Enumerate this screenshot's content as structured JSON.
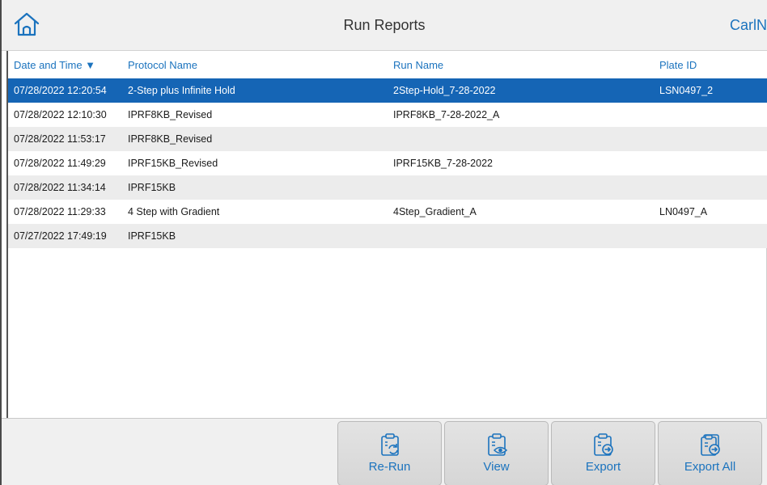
{
  "header": {
    "title": "Run Reports",
    "user": "CarlN"
  },
  "table": {
    "columns": [
      "Date and Time ▼",
      "Protocol Name",
      "Run Name",
      "Plate ID"
    ],
    "rows": [
      {
        "date": "07/28/2022 12:20:54",
        "protocol": "2-Step plus Infinite Hold",
        "run": "2Step-Hold_7-28-2022",
        "plate": "LSN0497_2"
      },
      {
        "date": "07/28/2022 12:10:30",
        "protocol": "IPRF8KB_Revised",
        "run": "IPRF8KB_7-28-2022_A",
        "plate": ""
      },
      {
        "date": "07/28/2022 11:53:17",
        "protocol": "IPRF8KB_Revised",
        "run": "",
        "plate": ""
      },
      {
        "date": "07/28/2022 11:49:29",
        "protocol": "IPRF15KB_Revised",
        "run": "IPRF15KB_7-28-2022",
        "plate": ""
      },
      {
        "date": "07/28/2022 11:34:14",
        "protocol": "IPRF15KB",
        "run": "",
        "plate": ""
      },
      {
        "date": "07/28/2022 11:29:33",
        "protocol": "4 Step with Gradient",
        "run": "4Step_Gradient_A",
        "plate": "LN0497_A"
      },
      {
        "date": "07/27/2022 17:49:19",
        "protocol": "IPRF15KB",
        "run": "",
        "plate": ""
      }
    ]
  },
  "footer": {
    "rerun_label": "Re-Run",
    "view_label": "View",
    "export_label": "Export",
    "export_all_label": "Export All"
  },
  "icons": {
    "home": "home-icon",
    "rerun": "clipboard-refresh-icon",
    "view": "clipboard-eye-icon",
    "export": "clipboard-export-icon",
    "export_all": "clipboards-export-icon"
  },
  "colors": {
    "accent": "#1b73be",
    "selected_row": "#1565b5",
    "header_bg": "#f0f0f0",
    "stripe": "#ececec"
  }
}
